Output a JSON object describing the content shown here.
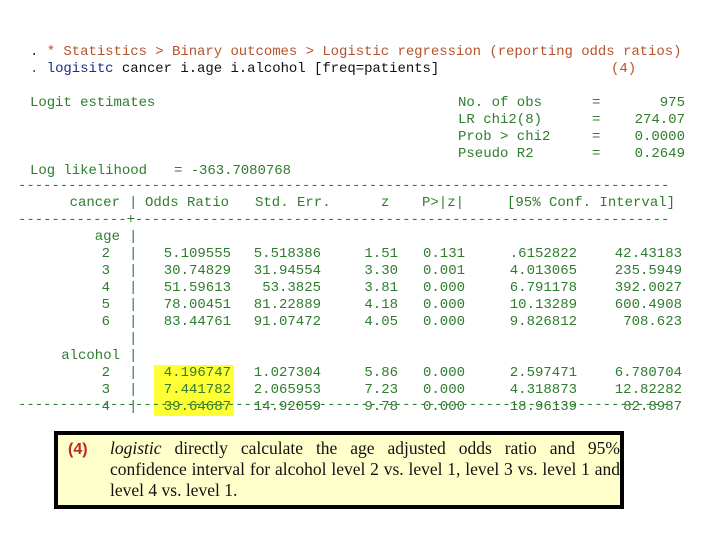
{
  "header": {
    "line1_prompt": ".",
    "line1_comment": "* Statistics > Binary outcomes > Logistic regression (reporting odds ratios)",
    "line2_prompt": ".",
    "line2_command": "logisitc",
    "line2_args": "cancer i.age i.alcohol [freq=patients]",
    "line2_ref": "(4)"
  },
  "summary": {
    "title": "Logit estimates",
    "stats": [
      {
        "label": "No. of obs",
        "eq": "=",
        "value": "975"
      },
      {
        "label": "LR chi2(8)",
        "eq": "=",
        "value": "274.07"
      },
      {
        "label": "Prob > chi2",
        "eq": "=",
        "value": "0.0000"
      },
      {
        "label": "Pseudo R2",
        "eq": "=",
        "value": "0.2649"
      }
    ],
    "loglik_label": "Log likelihood",
    "loglik_value": "= -363.7080768"
  },
  "table": {
    "rule": "------------------------------------------------------------------------------",
    "rule_mid": "-------------+----------------------------------------------------------------",
    "headers": {
      "depvar": "cancer",
      "sep": "|",
      "odds_ratio": "Odds Ratio",
      "std_err": "Std. Err.",
      "z": "z",
      "p": "P>|z|",
      "ci": "[95% Conf. Interval]"
    },
    "groups": [
      {
        "name": "age",
        "rows": [
          {
            "level": "2",
            "or": "5.109555",
            "se": "5.518386",
            "z": "1.51",
            "p": "0.131",
            "lo": ".6152822",
            "hi": "42.43183",
            "highlight": false
          },
          {
            "level": "3",
            "or": "30.74829",
            "se": "31.94554",
            "z": "3.30",
            "p": "0.001",
            "lo": "4.013065",
            "hi": "235.5949",
            "highlight": false
          },
          {
            "level": "4",
            "or": "51.59613",
            "se": "53.3825",
            "z": "3.81",
            "p": "0.000",
            "lo": "6.791178",
            "hi": "392.0027",
            "highlight": false
          },
          {
            "level": "5",
            "or": "78.00451",
            "se": "81.22889",
            "z": "4.18",
            "p": "0.000",
            "lo": "10.13289",
            "hi": "600.4908",
            "highlight": false
          },
          {
            "level": "6",
            "or": "83.44761",
            "se": "91.07472",
            "z": "4.05",
            "p": "0.000",
            "lo": "9.826812",
            "hi": "708.623",
            "highlight": false
          }
        ]
      },
      {
        "name": "alcohol",
        "rows": [
          {
            "level": "2",
            "or": "4.196747",
            "se": "1.027304",
            "z": "5.86",
            "p": "0.000",
            "lo": "2.597471",
            "hi": "6.780704",
            "highlight": true
          },
          {
            "level": "3",
            "or": "7.441782",
            "se": "2.065953",
            "z": "7.23",
            "p": "0.000",
            "lo": "4.318873",
            "hi": "12.82282",
            "highlight": true
          },
          {
            "level": "4",
            "or": "39.64687",
            "se": "14.92059",
            "z": "9.78",
            "p": "0.000",
            "lo": "18.96139",
            "hi": "82.8987",
            "highlight": true
          }
        ]
      }
    ]
  },
  "note": {
    "ref": "(4)",
    "italic": "logistic",
    "text": " directly calculate the age adjusted odds ratio and 95% confidence interval for alcohol level 2 vs. level 1, level 3 vs. level 1 and level 4 vs. level 1."
  },
  "colors": {
    "output_green": "#2e7d2e",
    "comment_brown": "#b5542b",
    "command_blue": "#1f2b8f",
    "highlight_yellow": "#ffff33",
    "note_bg": "#ffffcc",
    "note_ref_red": "#c0281e"
  }
}
